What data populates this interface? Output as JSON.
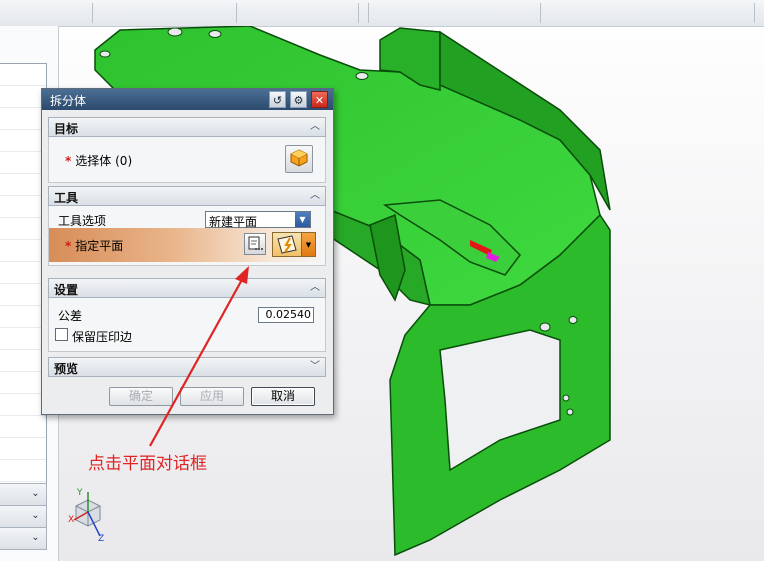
{
  "dialog": {
    "title": "拆分体",
    "sections": {
      "target": {
        "label": "目标",
        "select_body_label": "选择体",
        "select_body_count": "(0)"
      },
      "tool": {
        "label": "工具",
        "tool_option_label": "工具选项",
        "tool_option_value": "新建平面",
        "specify_plane_label": "指定平面"
      },
      "settings": {
        "label": "设置",
        "tolerance_label": "公差",
        "tolerance_value": "0.02540",
        "keep_imprint_label": "保留压印边",
        "keep_imprint_checked": false
      },
      "preview": {
        "label": "预览"
      }
    },
    "buttons": {
      "ok": "确定",
      "apply": "应用",
      "cancel": "取消"
    }
  },
  "annotation": {
    "text": "点击平面对话框",
    "color": "#e02424"
  },
  "triad": {
    "x": "X",
    "y": "Y",
    "z": "Z"
  },
  "colors": {
    "part_green": "#33cc33",
    "title_bar": "#2c4a6d",
    "highlight_orange": "#e9b58b",
    "close_red": "#d9382a"
  }
}
